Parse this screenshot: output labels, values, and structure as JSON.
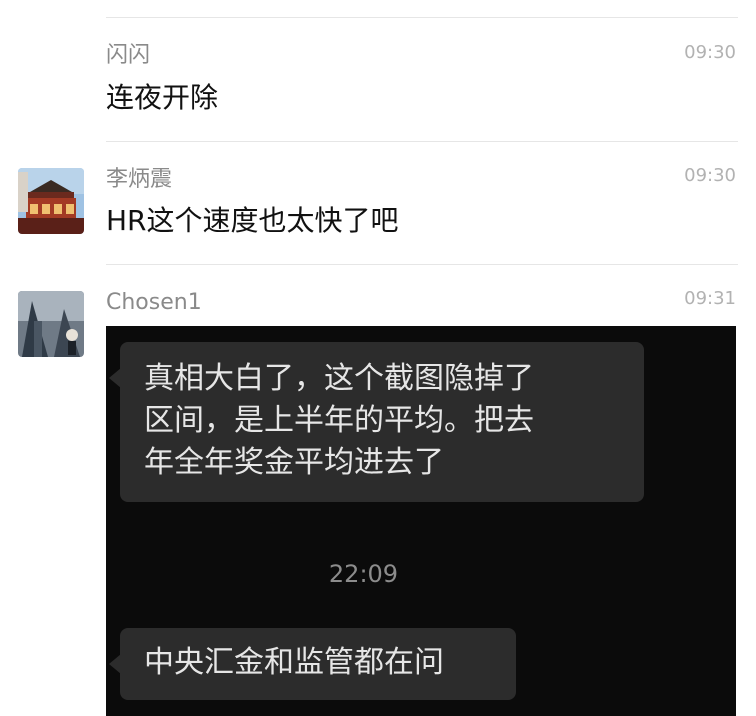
{
  "messages": [
    {
      "sender": "闪闪",
      "time": "09:30",
      "text": "连夜开除"
    },
    {
      "sender": "李炳震",
      "time": "09:30",
      "text": "HR这个速度也太快了吧"
    },
    {
      "sender": "Chosen1",
      "time": "09:31"
    }
  ],
  "screenshot": {
    "bubble1_lines": [
      "真相大白了，这个截图隐掉了",
      "区间，是上半年的平均。把去",
      "年全年奖金平均进去了"
    ],
    "timestamp": "22:09",
    "bubble2_text": "中央汇金和监管都在问"
  }
}
